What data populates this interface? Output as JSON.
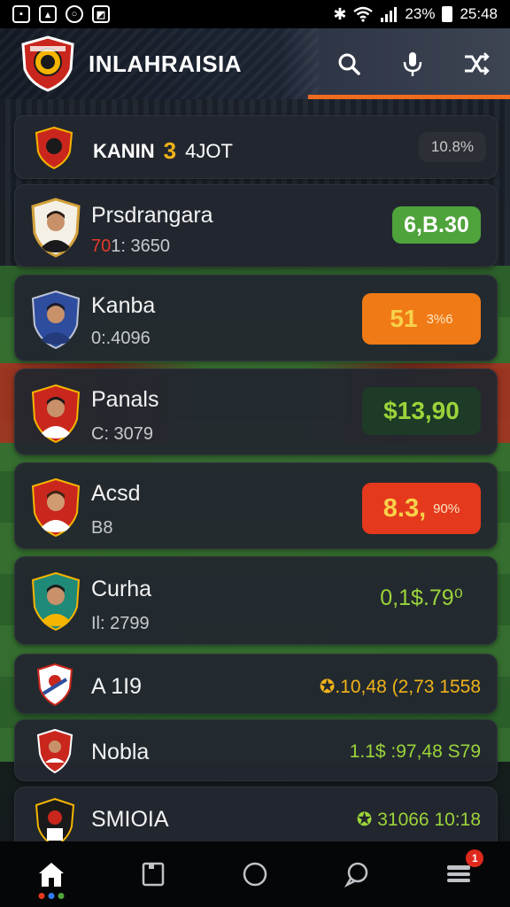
{
  "status_bar": {
    "left_icons": [
      "gallery-icon",
      "image-icon",
      "message-icon",
      "photo-icon"
    ],
    "bluetooth": "✱",
    "battery_percent": "23%",
    "time": "25:48"
  },
  "header": {
    "title": "INLAHRAISIA",
    "actions": [
      "search-icon",
      "microphone-icon",
      "shuffle-icon"
    ],
    "accent_color": "#ef6b1e"
  },
  "featured": {
    "label": "KANIN",
    "number": "3",
    "count": "4JOT",
    "badge": "10.8%"
  },
  "players": [
    {
      "name": "Prsdrangara",
      "sub_prefix": "70",
      "sub": "1: 3650",
      "value": "6,B.30",
      "pill_style": "green",
      "jersey": "#ffffff"
    },
    {
      "name": "Kanba",
      "sub_prefix": "",
      "sub": "0:.4096",
      "value": "51",
      "value_small": "3%6",
      "pill_style": "orange",
      "jersey": "#2f4d9e"
    },
    {
      "name": "Panals",
      "sub_prefix": "",
      "sub": "C: 3079",
      "value": "$13,90",
      "pill_style": "darkgreen",
      "jersey": "#ffffff"
    },
    {
      "name": "Acsd",
      "sub_prefix": "",
      "sub": "B8",
      "value": "8.3,",
      "value_small": "90%",
      "pill_style": "red",
      "jersey": "#ffffff"
    },
    {
      "name": "Curha",
      "sub_prefix": "",
      "sub": "Il: 2799",
      "value": "0,1$.79⁰",
      "pill_style": "text-green",
      "jersey": "#f4b400"
    }
  ],
  "teams": [
    {
      "name": "A 1I9",
      "value": "✪.10,48 (2,73 1558"
    },
    {
      "name": "Nobla",
      "value": "1.1$ :97,48 S79"
    },
    {
      "name": "SMIOIA",
      "value": "✪ 31066 10:18"
    }
  ],
  "bottom_nav": {
    "items": [
      "home-icon",
      "bookmark-icon",
      "circle-icon",
      "chat-icon",
      "menu-icon"
    ],
    "badge": "1"
  },
  "colors": {
    "green": "#4fa33b",
    "orange": "#f07a16",
    "red": "#e5391d",
    "lime": "#9bd43a",
    "gold": "#f0b21a"
  }
}
